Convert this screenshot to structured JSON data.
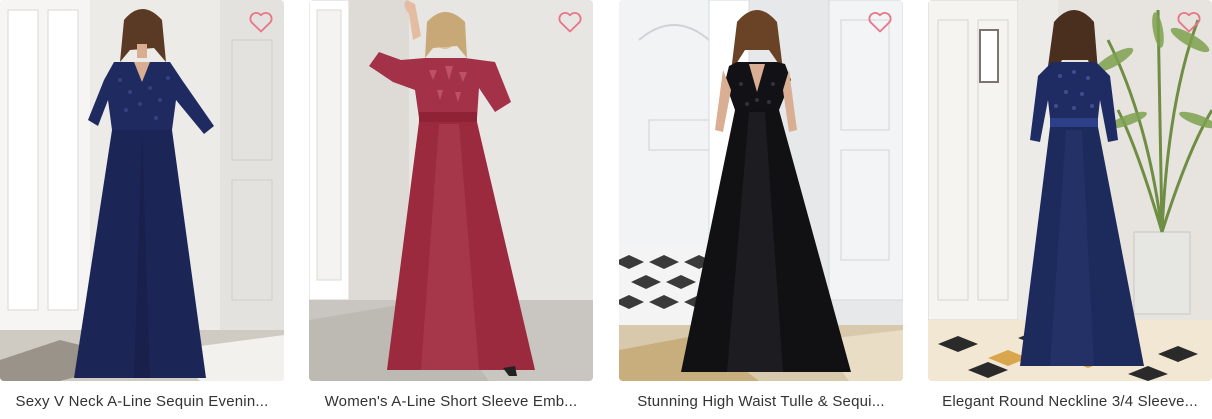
{
  "products": [
    {
      "title": "Sexy V Neck A-Line Sequin Evenin...",
      "image": "navy-sequin-v-neck-gown",
      "wishlist_icon": "heart-outline-icon",
      "colors": {
        "dress": "#1c2656",
        "bg": "#eceae6"
      }
    },
    {
      "title": "Women's A-Line Short Sleeve Emb...",
      "image": "burgundy-tulle-flutter-sleeve-gown",
      "wishlist_icon": "heart-outline-icon",
      "colors": {
        "dress": "#9b2a3e",
        "bg": "#e9e7e4"
      }
    },
    {
      "title": "Stunning High Waist Tulle & Sequi...",
      "image": "black-tulle-sequin-gown",
      "wishlist_icon": "heart-outline-icon",
      "colors": {
        "dress": "#111114",
        "bg": "#e2e4e6"
      }
    },
    {
      "title": "Elegant Round Neckline 3/4 Sleeve...",
      "image": "navy-round-neck-sequin-gown",
      "wishlist_icon": "heart-outline-icon",
      "colors": {
        "dress": "#1d2a5c",
        "bg": "#e6e3de"
      }
    }
  ],
  "accent": {
    "heart": "#e8768a"
  }
}
